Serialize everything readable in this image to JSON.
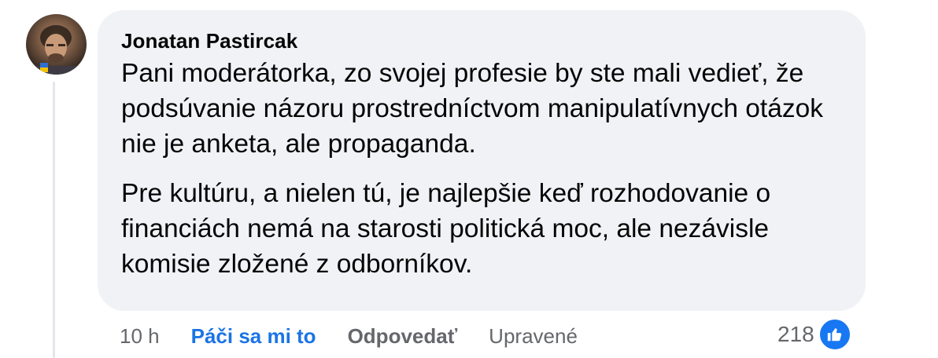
{
  "comment": {
    "author": "Jonatan Pastircak",
    "paragraphs": [
      "Pani moderátorka, zo svojej profesie by ste mali vedieť, že podsúvanie názoru prostredníctvom manipulatívnych otázok nie je anketa, ale propaganda.",
      "Pre kultúru, a nielen tú, je najlepšie keď rozhodovanie o financiách nemá na starosti politická moc, ale nezávisle komisie zložené z odborníkov."
    ],
    "time": "10 h",
    "like_label": "Páči sa mi to",
    "reply_label": "Odpovedať",
    "edited_label": "Upravené",
    "reaction_count": "218",
    "reaction_icon": "thumbs-up-icon"
  },
  "colors": {
    "bubble_bg": "#f0f2f5",
    "like_blue": "#1b74e4",
    "meta_gray": "#65676b",
    "badge_blue": "#1877f2"
  }
}
